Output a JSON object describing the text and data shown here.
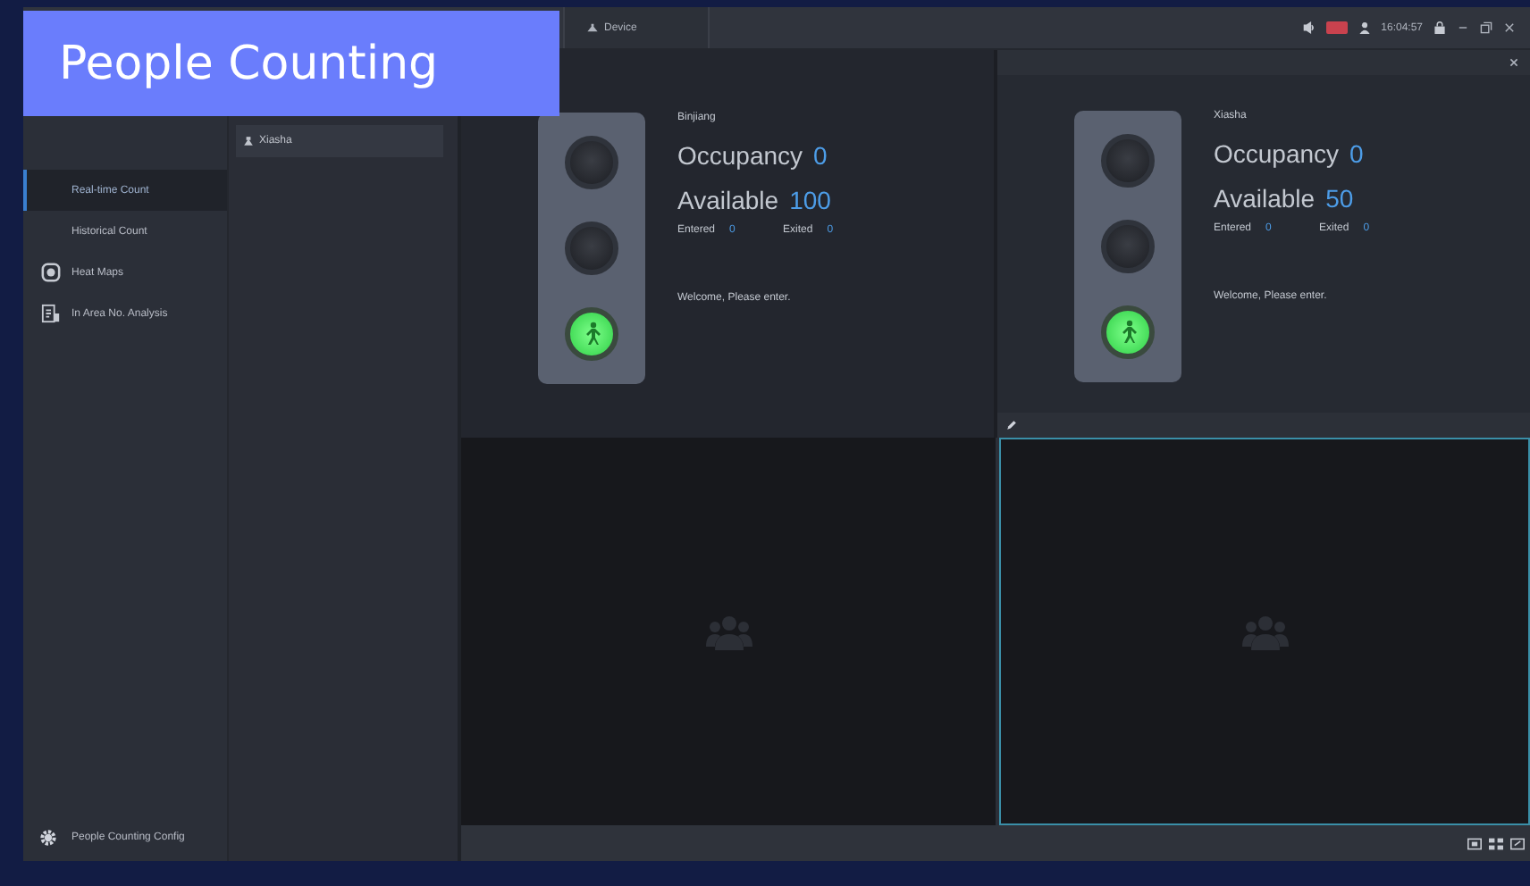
{
  "banner": {
    "title": "People Counting"
  },
  "title_bar": {
    "tab": "Device",
    "time": "16:04:57"
  },
  "sidebar": {
    "items": [
      {
        "label": "Real-time Count",
        "kind": "sub",
        "selected": true
      },
      {
        "label": "Historical Count",
        "kind": "sub",
        "selected": false
      },
      {
        "label": "Heat Maps",
        "kind": "heatmap",
        "selected": false
      },
      {
        "label": "In Area No. Analysis",
        "kind": "report",
        "selected": false
      }
    ],
    "footer": "People Counting Config"
  },
  "tree": {
    "items": [
      {
        "label": "Xiasha",
        "selected": true
      }
    ]
  },
  "panels": [
    {
      "name": "Binjiang",
      "occupancy_label": "Occupancy",
      "occupancy": "0",
      "available_label": "Available",
      "available": "100",
      "entered_label": "Entered",
      "entered": "0",
      "exited_label": "Exited",
      "exited": "0",
      "message": "Welcome, Please enter.",
      "lamps": [
        {
          "lit": false
        },
        {
          "lit": false
        },
        {
          "lit": true
        }
      ],
      "toolbar": false
    },
    {
      "name": "Xiasha",
      "occupancy_label": "Occupancy",
      "occupancy": "0",
      "available_label": "Available",
      "available": "50",
      "entered_label": "Entered",
      "entered": "0",
      "exited_label": "Exited",
      "exited": "0",
      "message": "Welcome, Please enter.",
      "lamps": [
        {
          "lit": false
        },
        {
          "lit": false
        },
        {
          "lit": true
        }
      ],
      "toolbar": true
    }
  ],
  "video_panes": [
    {
      "selected": false
    },
    {
      "selected": true
    }
  ]
}
